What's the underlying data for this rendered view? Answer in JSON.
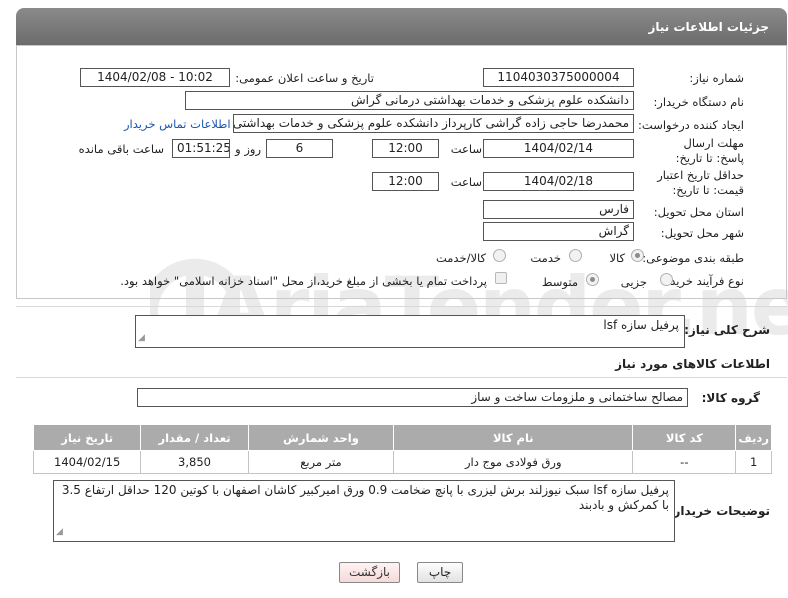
{
  "header": {
    "title": "جزئیات اطلاعات نیاز"
  },
  "fields": {
    "need_number_label": "شماره نیاز:",
    "need_number": "1104030375000004",
    "announce_label": "تاریخ و ساعت اعلان عمومی:",
    "announce_value": "1404/02/08 - 10:02",
    "buyer_org_label": "نام دستگاه خریدار:",
    "buyer_org": "دانشکده علوم پزشکی و خدمات بهداشتی  درمانی گراش",
    "requester_label": "ایجاد کننده درخواست:",
    "requester": "محمدرضا  حاجی زاده گراشی کارپرداز دانشکده علوم پزشکی و خدمات بهداشتی",
    "contact_link": "اطلاعات تماس خریدار",
    "deadline_label": "مهلت ارسال پاسخ: تا تاریخ:",
    "deadline_date": "1404/02/14",
    "time_label": "ساعت",
    "deadline_time": "12:00",
    "days_value": "6",
    "days_label": "روز و",
    "remaining_time": "01:51:25",
    "remaining_label": "ساعت باقی مانده",
    "validity_label": "حداقل تاریخ اعتبار قیمت: تا تاریخ:",
    "validity_date": "1404/02/18",
    "validity_time": "12:00",
    "province_label": "استان محل تحویل:",
    "province": "فارس",
    "city_label": "شهر محل تحویل:",
    "city": "گراش",
    "category_label": "طبقه بندی موضوعی:",
    "category_options": [
      "کالا",
      "خدمت",
      "کالا/خدمت"
    ],
    "process_label": "نوع فرآیند خرید :",
    "process_options": [
      "جزیی",
      "متوسط"
    ],
    "payment_note": "پرداخت تمام یا بخشی از مبلغ خرید،از محل \"اسناد خزانه اسلامی\" خواهد بود."
  },
  "description": {
    "label": "شرح کلی نیاز:",
    "value": "پرفیل سازه lsf"
  },
  "goods": {
    "section_title": "اطلاعات کالاهای مورد نیاز",
    "group_label": "گروه کالا:",
    "group_value": "مصالح ساختمانی و ملزومات ساخت و ساز",
    "columns": [
      "ردیف",
      "کد کالا",
      "نام کالا",
      "واحد شمارش",
      "تعداد / مقدار",
      "تاریخ نیاز"
    ],
    "rows": [
      [
        "1",
        "--",
        "ورق فولادی موج دار",
        "متر مربع",
        "3,850",
        "1404/02/15"
      ]
    ]
  },
  "buyer_notes": {
    "label": "توضیحات خریدار:",
    "value": "پرفیل سازه lsf سبک نیوزلند برش لیزری با پانچ ضخامت 0.9 ورق امیرکبیر کاشان اصفهان با کوتین 120 حداقل ارتفاع 3.5 با کمرکش و بادبند"
  },
  "buttons": {
    "print": "چاپ",
    "back": "بازگشت"
  },
  "watermark": "AriaTender.neT",
  "colors": {
    "header_bg": "#7a7a7a",
    "table_header": "#ababab",
    "link": "#1a56b0"
  }
}
